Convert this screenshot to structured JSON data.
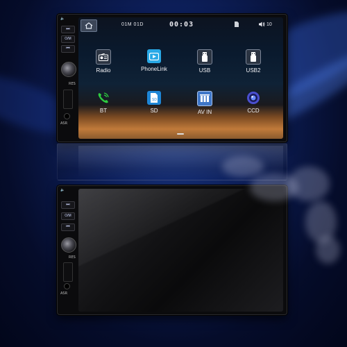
{
  "top_unit": {
    "side_panel": {
      "power_icon": "power-volume-icon",
      "buttons": [
        "⏭",
        "O/M",
        "⏮"
      ],
      "res_label": "RES",
      "asr_label": "ASR"
    },
    "status_bar": {
      "home_icon": "home-icon",
      "date": "01M 01D",
      "clock": "00:03",
      "sd_icon": "sd-card-icon",
      "volume_icon": "speaker-icon",
      "volume": "10"
    },
    "apps": [
      {
        "label": "Radio",
        "icon": "radio-icon",
        "color": "#2b3442"
      },
      {
        "label": "PhoneLink",
        "icon": "phonelink-icon",
        "color": "#29a9e6"
      },
      {
        "label": "USB",
        "icon": "usb-icon",
        "color": "#2b3442"
      },
      {
        "label": "USB2",
        "icon": "usb2-icon",
        "color": "#2b3442"
      },
      {
        "label": "BT",
        "icon": "bluetooth-phone-icon",
        "color": "#2ecc40"
      },
      {
        "label": "SD",
        "icon": "sd-icon",
        "color": "#1e86d6"
      },
      {
        "label": "AV IN",
        "icon": "av-in-icon",
        "color": "#3f77c8"
      },
      {
        "label": "CCD",
        "icon": "camera-icon",
        "color": "#4a4fd0"
      }
    ]
  },
  "bottom_unit": {
    "side_panel": {
      "power_icon": "power-volume-icon",
      "buttons": [
        "⏭",
        "O/M",
        "⏮"
      ],
      "res_label": "RES",
      "asr_label": "ASR"
    }
  },
  "colors": {
    "background": "#0d1f5a",
    "bezel": "#0b0b0d",
    "accent": "#29a9e6"
  }
}
